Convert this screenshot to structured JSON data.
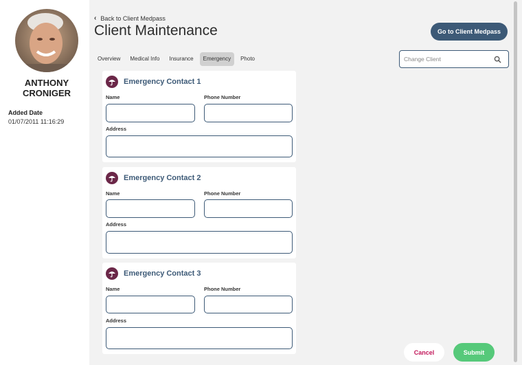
{
  "client": {
    "name_line1": "ANTHONY",
    "name_line2": "CRONIGER",
    "added_label": "Added Date",
    "added_value": "01/07/2011 11:16:29"
  },
  "header": {
    "back_label": "Back to Client Medpass",
    "title": "Client Maintenance",
    "go_button": "Go to Client Medpass"
  },
  "tabs": [
    {
      "label": "Overview",
      "active": false
    },
    {
      "label": "Medical Info",
      "active": false
    },
    {
      "label": "Insurance",
      "active": false
    },
    {
      "label": "Emergency",
      "active": true
    },
    {
      "label": "Photo",
      "active": false
    }
  ],
  "search": {
    "placeholder": "Change Client"
  },
  "contacts": [
    {
      "title": "Emergency Contact 1",
      "name_label": "Name",
      "phone_label": "Phone Number",
      "address_label": "Address"
    },
    {
      "title": "Emergency Contact 2",
      "name_label": "Name",
      "phone_label": "Phone Number",
      "address_label": "Address"
    },
    {
      "title": "Emergency Contact 3",
      "name_label": "Name",
      "phone_label": "Phone Number",
      "address_label": "Address"
    }
  ],
  "footer": {
    "cancel": "Cancel",
    "submit": "Submit"
  },
  "colors": {
    "primary": "#3d5a77",
    "accent": "#6b2748",
    "submit": "#56c97a",
    "cancel_text": "#c2185b"
  },
  "icons": [
    "chevron-left-icon",
    "search-icon",
    "umbrella-icon"
  ]
}
